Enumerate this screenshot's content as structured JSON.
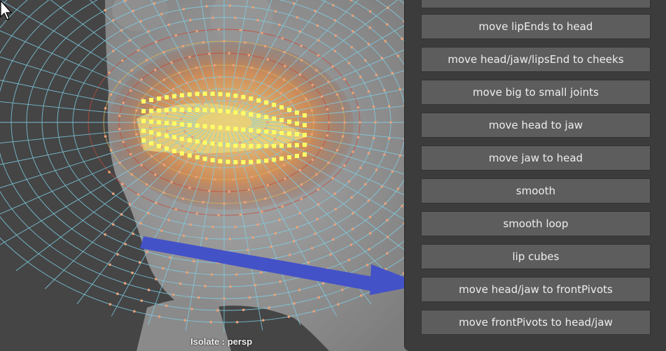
{
  "viewport": {
    "isolate_label": "Isolate : persp"
  },
  "panel": {
    "buttons": [
      {
        "label": ""
      },
      {
        "label": "move lipEnds to head"
      },
      {
        "label": "move head/jaw/lipsEnd to cheeks"
      },
      {
        "label": "move big to small joints"
      },
      {
        "label": "move head to jaw"
      },
      {
        "label": "move jaw to head"
      },
      {
        "label": "smooth"
      },
      {
        "label": "smooth loop"
      },
      {
        "label": "lip cubes"
      },
      {
        "label": "move head/jaw to frontPivots"
      },
      {
        "label": "move frontPivots to head/jaw"
      }
    ]
  },
  "colors": {
    "wire": "#7fd0e6",
    "vertex": "#e9a27a",
    "selected_vertex": "#ffff66",
    "arrow": "#4452c8",
    "button_bg": "#5d5d5d",
    "panel_bg": "#3c3c3c"
  },
  "icons": [
    "mouse-cursor-icon",
    "arrow-annotation-icon"
  ]
}
